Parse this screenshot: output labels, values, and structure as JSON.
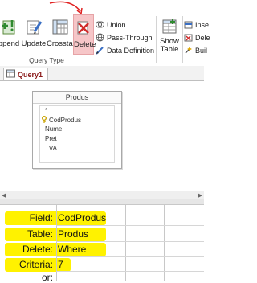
{
  "ribbon": {
    "buttons": [
      {
        "name": "append",
        "label": "ppend"
      },
      {
        "name": "update",
        "label": "Update"
      },
      {
        "name": "crosstab",
        "label": "Crosstab"
      },
      {
        "name": "delete",
        "label": "Delete"
      }
    ],
    "small_items": [
      {
        "name": "union",
        "label": "Union"
      },
      {
        "name": "pass-through",
        "label": "Pass-Through"
      },
      {
        "name": "data-definition",
        "label": "Data Definition"
      }
    ],
    "show_table": {
      "line1": "Show",
      "line2": "Table"
    },
    "right_items": [
      {
        "name": "insert",
        "label": "Inse"
      },
      {
        "name": "delete-rows",
        "label": "Dele"
      },
      {
        "name": "builder",
        "label": "Buil"
      }
    ],
    "group_label": "Query Type"
  },
  "tab": {
    "label": "Query1"
  },
  "table_box": {
    "title": "Produs",
    "fields": [
      "*",
      "CodProdus",
      "Nume",
      "Pret",
      "TVA"
    ]
  },
  "grid": {
    "rows": [
      {
        "label": "Field:",
        "value": "CodProdus"
      },
      {
        "label": "Table:",
        "value": "Produs"
      },
      {
        "label": "Delete:",
        "value": "Where"
      },
      {
        "label": "Criteria:",
        "value": "7"
      },
      {
        "label": "or:",
        "value": ""
      }
    ]
  },
  "colors": {
    "highlight": "#fff200",
    "active_button": "#f6c6c8",
    "arrow": "#e02020",
    "tab_text": "#8b1a1a"
  }
}
